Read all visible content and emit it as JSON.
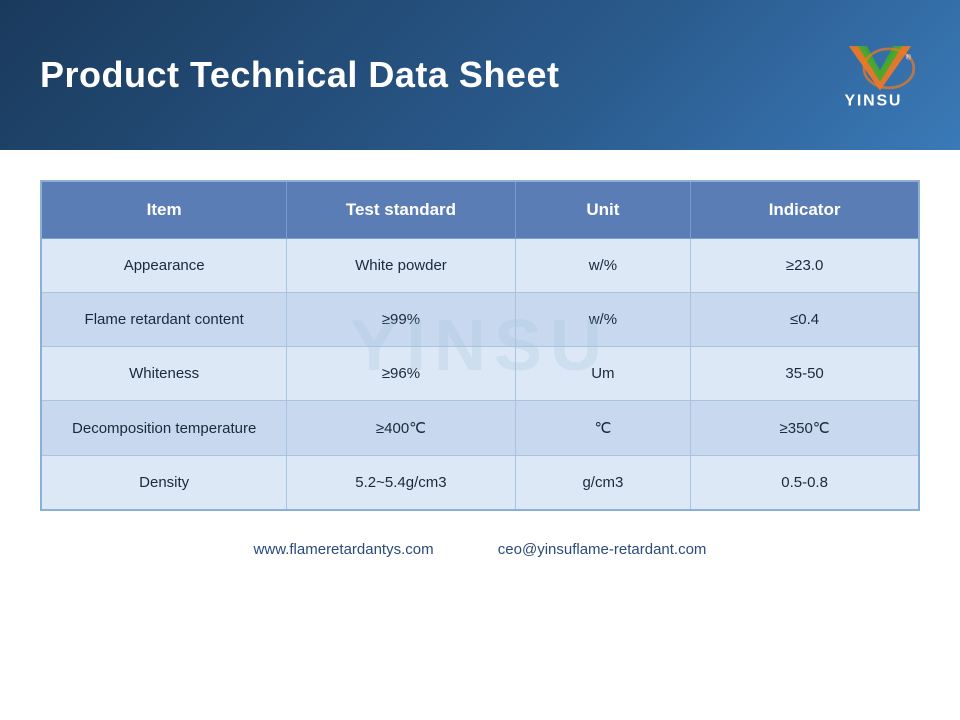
{
  "header": {
    "title": "Product Technical Data Sheet",
    "logo_text": "YINSU"
  },
  "table": {
    "columns": [
      "Item",
      "Test standard",
      "Unit",
      "Indicator"
    ],
    "rows": [
      {
        "item": "Appearance",
        "test_standard": "White powder",
        "unit": "w/%",
        "indicator": "≥23.0",
        "row_class": "row-light"
      },
      {
        "item": "Flame retardant content",
        "test_standard": "≥99%",
        "unit": "w/%",
        "indicator": "≤0.4",
        "row_class": "row-dark"
      },
      {
        "item": "Whiteness",
        "test_standard": "≥96%",
        "unit": "Um",
        "indicator": "35-50",
        "row_class": "row-light"
      },
      {
        "item": "Decomposition temperature",
        "test_standard": "≥400℃",
        "unit": "℃",
        "indicator": "≥350℃",
        "row_class": "row-dark"
      },
      {
        "item": "Density",
        "test_standard": "5.2~5.4g/cm3",
        "unit": "g/cm3",
        "indicator": "0.5-0.8",
        "row_class": "row-light"
      }
    ]
  },
  "footer": {
    "website": "www.flameretardantys.com",
    "email": "ceo@yinsuflame-retardant.com"
  },
  "watermark": "YINSU"
}
